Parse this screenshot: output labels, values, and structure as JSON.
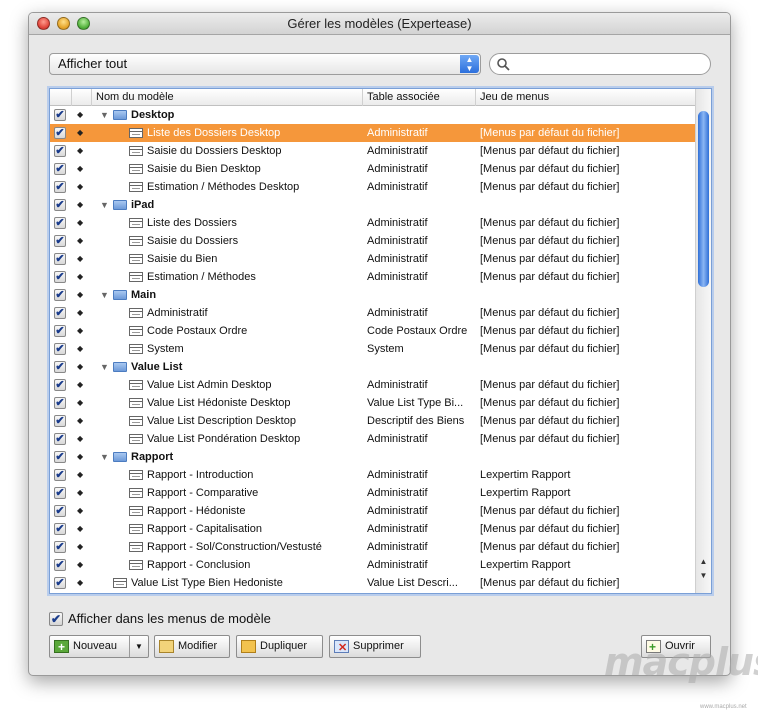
{
  "window": {
    "title": "Gérer les modèles (Expertease)"
  },
  "filter": {
    "selected": "Afficher tout"
  },
  "search": {
    "placeholder": ""
  },
  "table": {
    "headers": [
      "Nom du modèle",
      "Table associée",
      "Jeu de menus"
    ],
    "rows": [
      {
        "kind": "folder",
        "name": "Desktop",
        "table": "",
        "menu": ""
      },
      {
        "kind": "layout",
        "name": "Liste des Dossiers Desktop",
        "table": "Administratif",
        "menu": "[Menus par défaut du fichier]",
        "selected": true
      },
      {
        "kind": "layout",
        "name": "Saisie du Dossiers Desktop",
        "table": "Administratif",
        "menu": "[Menus par défaut du fichier]"
      },
      {
        "kind": "layout",
        "name": "Saisie du Bien Desktop",
        "table": "Administratif",
        "menu": "[Menus par défaut du fichier]"
      },
      {
        "kind": "layout",
        "name": "Estimation / Méthodes Desktop",
        "table": "Administratif",
        "menu": "[Menus par défaut du fichier]"
      },
      {
        "kind": "folder",
        "name": "iPad",
        "table": "",
        "menu": ""
      },
      {
        "kind": "layout",
        "name": "Liste des Dossiers",
        "table": "Administratif",
        "menu": "[Menus par défaut du fichier]"
      },
      {
        "kind": "layout",
        "name": "Saisie du Dossiers",
        "table": "Administratif",
        "menu": "[Menus par défaut du fichier]"
      },
      {
        "kind": "layout",
        "name": "Saisie du Bien",
        "table": "Administratif",
        "menu": "[Menus par défaut du fichier]"
      },
      {
        "kind": "layout",
        "name": "Estimation / Méthodes",
        "table": "Administratif",
        "menu": "[Menus par défaut du fichier]"
      },
      {
        "kind": "folder",
        "name": "Main",
        "table": "",
        "menu": ""
      },
      {
        "kind": "layout",
        "name": "Administratif",
        "table": "Administratif",
        "menu": "[Menus par défaut du fichier]"
      },
      {
        "kind": "layout",
        "name": "Code Postaux Ordre",
        "table": "Code Postaux Ordre",
        "menu": "[Menus par défaut du fichier]"
      },
      {
        "kind": "layout",
        "name": "System",
        "table": "System",
        "menu": "[Menus par défaut du fichier]"
      },
      {
        "kind": "folder",
        "name": "Value List",
        "table": "",
        "menu": ""
      },
      {
        "kind": "layout",
        "name": "Value List Admin Desktop",
        "table": "Administratif",
        "menu": "[Menus par défaut du fichier]"
      },
      {
        "kind": "layout",
        "name": "Value List Hédoniste Desktop",
        "table": "Value List Type Bi...",
        "menu": "[Menus par défaut du fichier]"
      },
      {
        "kind": "layout",
        "name": "Value List Description Desktop",
        "table": "Descriptif des Biens",
        "menu": "[Menus par défaut du fichier]"
      },
      {
        "kind": "layout",
        "name": "Value List Pondération Desktop",
        "table": "Administratif",
        "menu": "[Menus par défaut du fichier]"
      },
      {
        "kind": "folder",
        "name": "Rapport",
        "table": "",
        "menu": ""
      },
      {
        "kind": "layout",
        "name": "Rapport - Introduction",
        "table": "Administratif",
        "menu": "Lexpertim Rapport"
      },
      {
        "kind": "layout",
        "name": "Rapport - Comparative",
        "table": "Administratif",
        "menu": "Lexpertim Rapport"
      },
      {
        "kind": "layout",
        "name": "Rapport - Hédoniste",
        "table": "Administratif",
        "menu": "[Menus par défaut du fichier]"
      },
      {
        "kind": "layout",
        "name": "Rapport - Capitalisation",
        "table": "Administratif",
        "menu": "[Menus par défaut du fichier]"
      },
      {
        "kind": "layout",
        "name": "Rapport - Sol/Construction/Vestusté",
        "table": "Administratif",
        "menu": "[Menus par défaut du fichier]"
      },
      {
        "kind": "layout",
        "name": "Rapport - Conclusion",
        "table": "Administratif",
        "menu": "Lexpertim Rapport"
      },
      {
        "kind": "toplayout",
        "name": "Value List Type Bien Hedoniste",
        "table": "Value List Descri...",
        "menu": "[Menus par défaut du fichier]"
      }
    ]
  },
  "show_in_menus": {
    "label": "Afficher dans les menus de modèle",
    "checked": true
  },
  "buttons": {
    "new": "Nouveau",
    "modify": "Modifier",
    "duplicate": "Dupliquer",
    "delete": "Supprimer",
    "open": "Ouvrir"
  },
  "watermark": {
    "text": "macplus",
    "small": "www.macplus.net"
  },
  "colors": {
    "selection": "#f5973b",
    "accent": "#2c6fdc"
  }
}
